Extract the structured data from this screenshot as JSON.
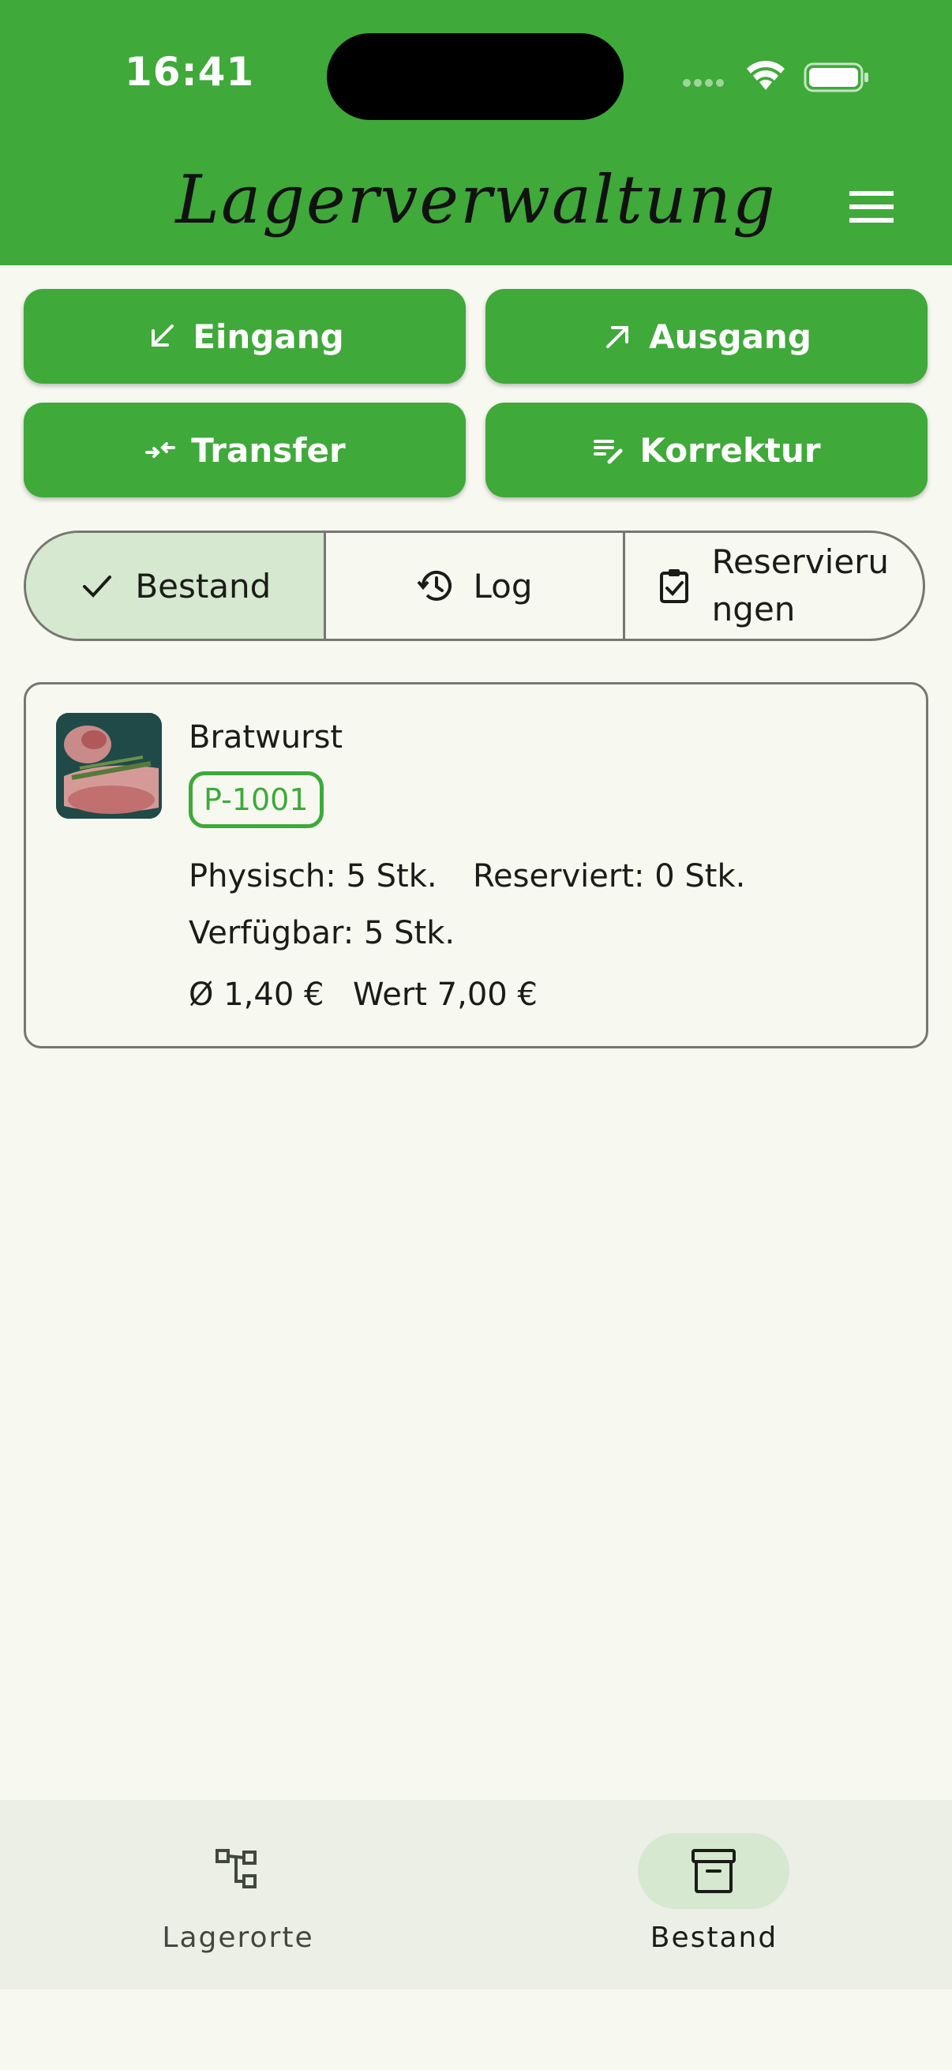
{
  "status_bar": {
    "time": "16:41"
  },
  "header": {
    "title": "Lagerverwaltung"
  },
  "actions": {
    "eingang": "Eingang",
    "ausgang": "Ausgang",
    "transfer": "Transfer",
    "korrektur": "Korrektur"
  },
  "tabs": {
    "bestand": "Bestand",
    "log": "Log",
    "reservierungen": "Reservierungen",
    "active": "bestand"
  },
  "product": {
    "name": "Bratwurst",
    "sku": "P-1001",
    "physisch": "Physisch: 5 Stk.",
    "reserviert": "Reserviert: 0 Stk.",
    "verfuegbar": "Verfügbar: 5 Stk.",
    "avg_price": "Ø 1,40 €",
    "value": "Wert 7,00 €"
  },
  "bottom_nav": {
    "lagerorte": "Lagerorte",
    "bestand": "Bestand",
    "active": "bestand"
  },
  "colors": {
    "primary": "#3fa93a",
    "background": "#f7f9f1",
    "selected_container": "#d6e8cf",
    "nav_background": "#ecefe6"
  }
}
